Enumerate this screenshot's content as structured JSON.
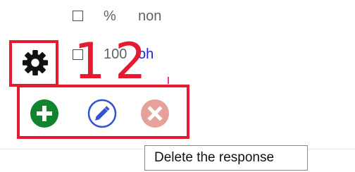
{
  "rows": [
    {
      "col1": "%",
      "col2": "non"
    },
    {
      "col1": "100",
      "col2": "oh"
    }
  ],
  "annotations": {
    "number_1": "1",
    "number_2": "2",
    "color": "#e5192f"
  },
  "icons": {
    "settings": "gear-icon",
    "add": "plus-icon",
    "edit": "pencil-icon",
    "delete": "x-icon"
  },
  "colors": {
    "add": "#12832f",
    "edit": "#3550d1",
    "delete_disabled": "#e8a09a",
    "link": "#1a1aff"
  },
  "tooltip": {
    "text": "Delete the response"
  }
}
